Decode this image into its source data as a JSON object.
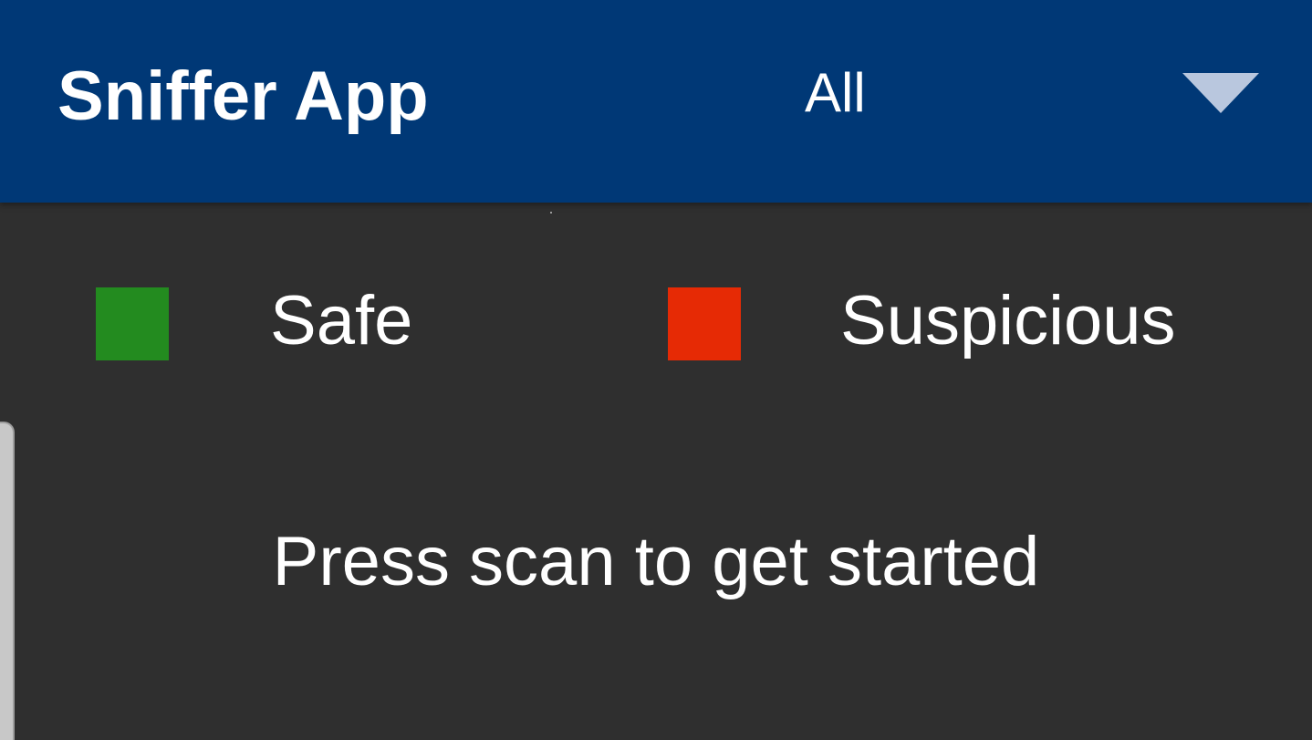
{
  "app_bar": {
    "title": "Sniffer App",
    "background_color": "#003876",
    "filter": {
      "selected_value": "All",
      "icon": "dropdown-triangle-icon"
    }
  },
  "legend": {
    "items": [
      {
        "label": "Safe",
        "color": "#238b1f"
      },
      {
        "label": "Suspicious",
        "color": "#e62a05"
      }
    ]
  },
  "main": {
    "empty_state_message": "Press scan to get started"
  }
}
